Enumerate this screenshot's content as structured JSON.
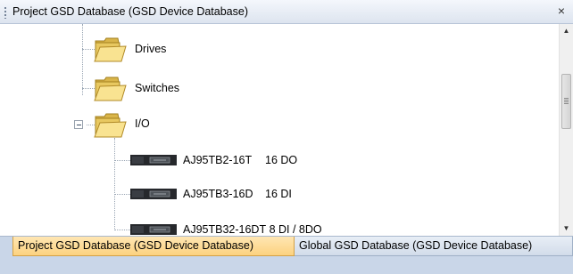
{
  "window": {
    "title": "Project GSD Database (GSD Device Database)",
    "close_glyph": "×"
  },
  "tree": {
    "folders": [
      {
        "label": "Drives",
        "icon": "folder-icon",
        "expanded": false
      },
      {
        "label": "Switches",
        "icon": "folder-icon",
        "expanded": false
      },
      {
        "label": "I/O",
        "icon": "folder-icon",
        "expanded": true,
        "expander_glyph": "minus-icon"
      }
    ],
    "devices": [
      {
        "name": "AJ95TB2-16T",
        "desc": "16 DO",
        "icon": "device-module-icon"
      },
      {
        "name": "AJ95TB3-16D",
        "desc": "16 DI",
        "icon": "device-module-icon"
      },
      {
        "name": "AJ95TB32-16DT",
        "desc": "8 DI / 8DO",
        "icon": "device-module-icon"
      }
    ]
  },
  "scrollbar": {
    "up_glyph": "▲",
    "down_glyph": "▼"
  },
  "tabs": [
    {
      "label": "Project GSD Database (GSD Device Database)",
      "active": true
    },
    {
      "label": "Global GSD Database (GSD Device Database)",
      "active": false
    }
  ],
  "colors": {
    "active_tab": "#fcd27f",
    "tab_bar": "#c9d6e8",
    "title_bar": "#dde4ef"
  }
}
